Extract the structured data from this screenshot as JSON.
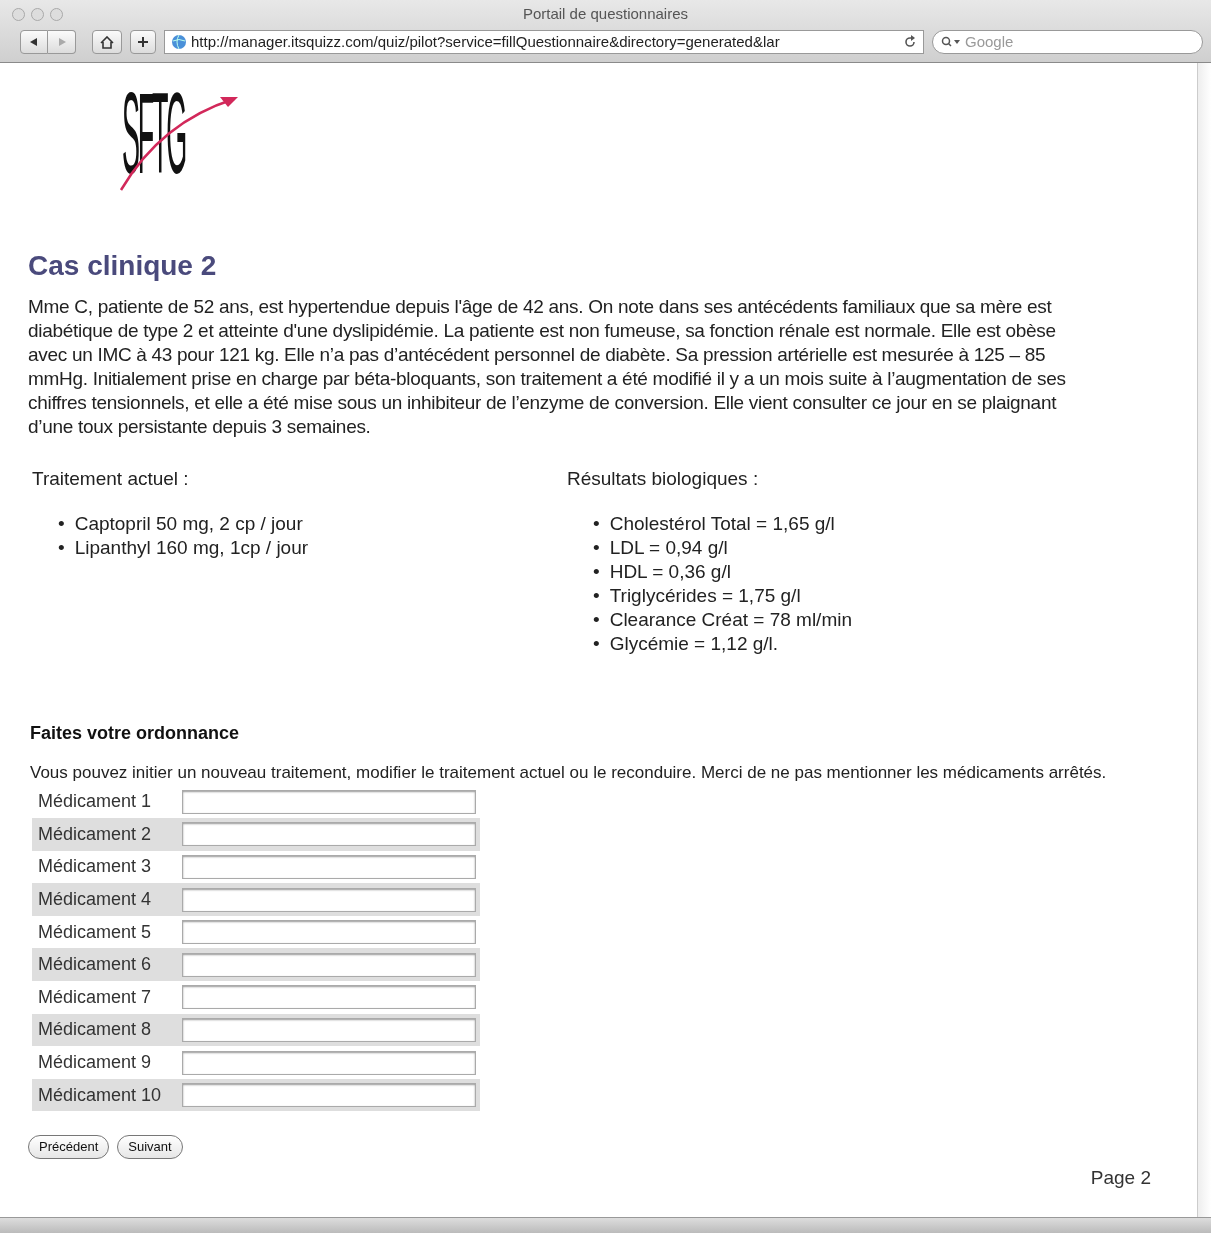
{
  "window": {
    "title": "Portail de questionnaires"
  },
  "toolbar": {
    "url": "http://manager.itsquizz.com/quiz/pilot?service=fillQuestionnaire&directory=generated&lar",
    "search_placeholder": "Google"
  },
  "logo": {
    "text": "SFTG"
  },
  "case": {
    "title": "Cas clinique 2",
    "description": "Mme C, patiente de 52 ans, est hypertendue depuis l'âge de 42 ans. On note dans ses antécédents familiaux que sa mère est diabétique de type 2 et atteinte d'une dyslipidémie. La patiente est non fumeuse, sa fonction rénale est normale. Elle est obèse avec un IMC à 43 pour 121 kg. Elle n’a pas d’antécédent personnel de diabète. Sa pression artérielle est mesurée à 125 – 85 mmHg. Initialement prise en charge par béta-bloquants, son traitement a été modifié il y a un mois suite à l’augmentation de ses chiffres tensionnels, et elle a été mise sous un inhibiteur de l’enzyme de conversion. Elle vient consulter ce jour en se plaignant d’une toux persistante depuis 3 semaines."
  },
  "columns": [
    {
      "heading": "Traitement actuel :",
      "bullet": "•",
      "items": [
        "Captopril 50 mg, 2 cp / jour",
        "Lipanthyl 160 mg, 1cp / jour"
      ]
    },
    {
      "heading": "Résultats biologiques :",
      "bullet": "•",
      "items": [
        "Cholestérol Total = 1,65 g/l",
        "LDL = 0,94 g/l",
        "HDL = 0,36 g/l",
        "Triglycérides = 1,75 g/l",
        "Clearance Créat = 78 ml/min",
        "Glycémie = 1,12 g/l."
      ]
    }
  ],
  "prescription": {
    "title": "Faites votre ordonnance",
    "instructions": "Vous pouvez initier un nouveau traitement, modifier le traitement actuel ou le reconduire. Merci de ne pas mentionner les médicaments arrêtés.",
    "fields": [
      {
        "label": "Médicament 1"
      },
      {
        "label": "Médicament 2"
      },
      {
        "label": "Médicament 3"
      },
      {
        "label": "Médicament 4"
      },
      {
        "label": "Médicament 5"
      },
      {
        "label": "Médicament 6"
      },
      {
        "label": "Médicament 7"
      },
      {
        "label": "Médicament 8"
      },
      {
        "label": "Médicament 9"
      },
      {
        "label": "Médicament 10"
      }
    ]
  },
  "buttons": [
    "Précédent",
    "Suivant"
  ],
  "page_indicator": "Page 2"
}
